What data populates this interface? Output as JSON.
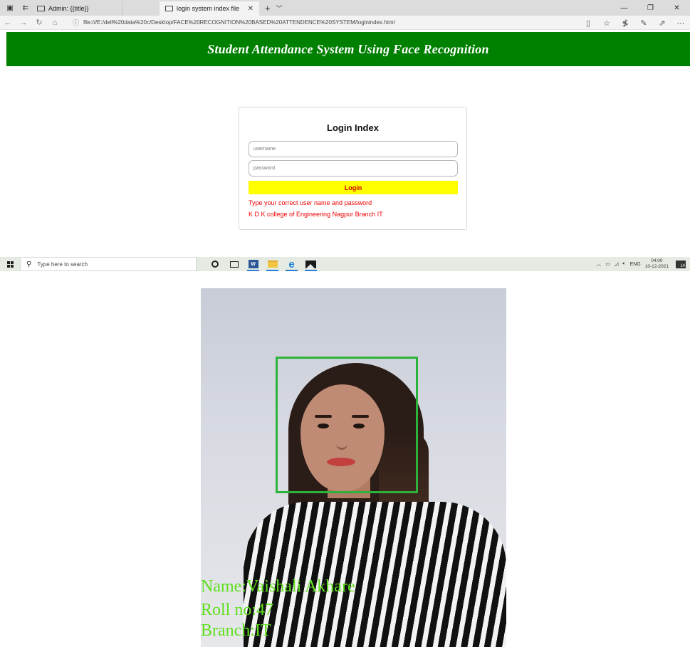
{
  "browser": {
    "tabs": [
      {
        "label": "Admin: {{title}}",
        "active": false
      },
      {
        "label": "login system index file",
        "active": true
      }
    ],
    "url": "file:///E:/dell%20data%20c/Desktop/FACE%20RECOGNITION%20BASED%20ATTENDENCE%20SYSTEM/loginindex.html"
  },
  "page": {
    "banner_title": "Student Attendance System Using Face Recognition",
    "login": {
      "title": "Login Index",
      "username_placeholder": "username",
      "password_placeholder": "password",
      "button_label": "Login",
      "message_1": "Type your correct user name and password",
      "message_2": "K D K  college of Engineering Nagpur Branch IT"
    }
  },
  "taskbar": {
    "search_placeholder": "Type here to search",
    "language": "ENG",
    "time": "04:00",
    "date": "10-12-2021",
    "notification_count": "14"
  },
  "photo": {
    "name_label": "Name:Vaishali Akhare",
    "roll_label": "Roll no:47",
    "branch_label": "Branch:IT",
    "box_color": "#2db33a",
    "text_color": "#5ee01c"
  },
  "colors": {
    "banner": "#008000",
    "login_button": "#ffff00",
    "login_text": "#cc0000",
    "message_text": "#ee0000"
  }
}
